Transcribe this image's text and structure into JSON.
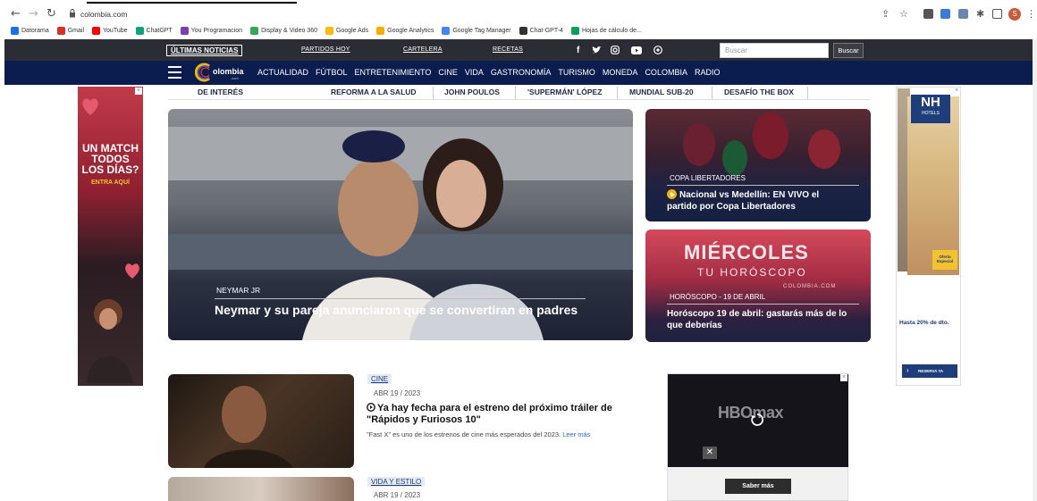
{
  "browser": {
    "url": "colombia.com",
    "profile_initial": "S",
    "bookmarks": [
      {
        "label": "Datorama",
        "color": "#1a73e8"
      },
      {
        "label": "Gmail",
        "color": "#d93025"
      },
      {
        "label": "YouTube",
        "color": "#ff0000"
      },
      {
        "label": "ChatGPT",
        "color": "#10a37f"
      },
      {
        "label": "You Programacion",
        "color": "#7b3fb4"
      },
      {
        "label": "Display & Video 360",
        "color": "#34a853"
      },
      {
        "label": "Google Ads",
        "color": "#fbbc05"
      },
      {
        "label": "Google Analytics",
        "color": "#f9ab00"
      },
      {
        "label": "Google Tag Manager",
        "color": "#4285f4"
      },
      {
        "label": "Chat-GPT-4",
        "color": "#333333"
      },
      {
        "label": "Hojas de cálculo de...",
        "color": "#0f9d58"
      }
    ]
  },
  "topbar": {
    "ultimas": "ÚLTIMAS NOTICIAS",
    "links": [
      "PARTIDOS HOY",
      "CARTELERA",
      "RECETAS"
    ],
    "search_placeholder": "Buscar",
    "search_button": "Buscar"
  },
  "logo": {
    "text": "olombia",
    "sub": ".com"
  },
  "nav": {
    "items": [
      "ACTUALIDAD",
      "FÚTBOL",
      "ENTRETENIMIENTO",
      "CINE",
      "VIDA",
      "GASTRONOMÍA",
      "TURISMO",
      "MONEDA",
      "COLOMBIA",
      "RADIO"
    ]
  },
  "subnav": {
    "label": "DE INTERÉS",
    "items": [
      "REFORMA A LA SALUD",
      "JOHN POULOS",
      "'SUPERMÁN' LÓPEZ",
      "MUNDIAL SUB-20",
      "DESAFÍO THE BOX"
    ]
  },
  "hero": {
    "category": "NEYMAR JR",
    "title": "Neymar y su pareja anunciaron que se convertiran en padres"
  },
  "card1": {
    "category": "COPA LIBERTADORES",
    "title_line1": "Nacional vs Medellín: EN VIVO el",
    "title_line2": "partido por Copa Libertadores"
  },
  "card2": {
    "banner_title": "MIÉRCOLES",
    "banner_sub": "TU HORÓSCOPO",
    "banner_site": "COLOMBIA.COM",
    "category": "HORÓSCOPO - 19 DE ABRIL",
    "title_line1": "Horóscopo 19 de abril: gastarás más de lo",
    "title_line2": "que deberías"
  },
  "article1": {
    "tag": "CINE",
    "date": "ABR 19 / 2023",
    "title_line1": "Ya hay fecha para el estreno del próximo tráiler de",
    "title_line2": "\"Rápidos y Furiosos 10\"",
    "desc": "\"Fast X\" es uno de los estrenos de cine más esperados del 2023.",
    "read_more": "Leer más"
  },
  "article2": {
    "tag": "VIDA Y ESTILO",
    "date": "ABR 19 / 2023"
  },
  "ads": {
    "left_lines": [
      "UN MATCH",
      "TODOS",
      "LOS DÍAS?"
    ],
    "left_cta": "ENTRA AQUÍ",
    "right_brand": "NH",
    "right_brand_sub": "HOTELS",
    "right_offer": "Hasta 20% de dto.",
    "right_badge": "Oferta Especial",
    "right_cta": "RESERVA YA",
    "hbo_logo": "HBOmax",
    "hbo_cta": "Saber más"
  }
}
